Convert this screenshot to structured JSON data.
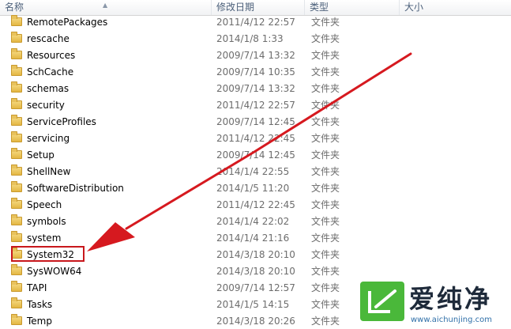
{
  "columns": {
    "name": "名称",
    "date": "修改日期",
    "type": "类型",
    "size": "大小"
  },
  "rows": [
    {
      "name": "RemotePackages",
      "date": "2011/4/12 22:57",
      "type": "文件夹"
    },
    {
      "name": "rescache",
      "date": "2014/1/8 1:33",
      "type": "文件夹"
    },
    {
      "name": "Resources",
      "date": "2009/7/14 13:32",
      "type": "文件夹"
    },
    {
      "name": "SchCache",
      "date": "2009/7/14 10:35",
      "type": "文件夹"
    },
    {
      "name": "schemas",
      "date": "2009/7/14 13:32",
      "type": "文件夹"
    },
    {
      "name": "security",
      "date": "2011/4/12 22:57",
      "type": "文件夹"
    },
    {
      "name": "ServiceProfiles",
      "date": "2009/7/14 12:45",
      "type": "文件夹"
    },
    {
      "name": "servicing",
      "date": "2011/4/12 22:45",
      "type": "文件夹"
    },
    {
      "name": "Setup",
      "date": "2009/7/14 12:45",
      "type": "文件夹"
    },
    {
      "name": "ShellNew",
      "date": "2014/1/4 22:55",
      "type": "文件夹"
    },
    {
      "name": "SoftwareDistribution",
      "date": "2014/1/5 11:20",
      "type": "文件夹"
    },
    {
      "name": "Speech",
      "date": "2011/4/12 22:45",
      "type": "文件夹"
    },
    {
      "name": "symbols",
      "date": "2014/1/4 22:02",
      "type": "文件夹"
    },
    {
      "name": "system",
      "date": "2014/1/4 21:16",
      "type": "文件夹"
    },
    {
      "name": "System32",
      "date": "2014/3/18 20:10",
      "type": "文件夹"
    },
    {
      "name": "SysWOW64",
      "date": "2014/3/18 20:10",
      "type": "文件夹"
    },
    {
      "name": "TAPI",
      "date": "2009/7/14 12:57",
      "type": "文件夹"
    },
    {
      "name": "Tasks",
      "date": "2014/1/5 14:15",
      "type": "文件夹"
    },
    {
      "name": "Temp",
      "date": "2014/3/18 20:26",
      "type": "文件夹"
    }
  ],
  "watermark": {
    "brand": "爱纯净",
    "url": "www.aichunjing.com"
  },
  "colors": {
    "highlight": "#c8171c",
    "arrow": "#d6191f",
    "logo_green": "#4ab83a"
  }
}
